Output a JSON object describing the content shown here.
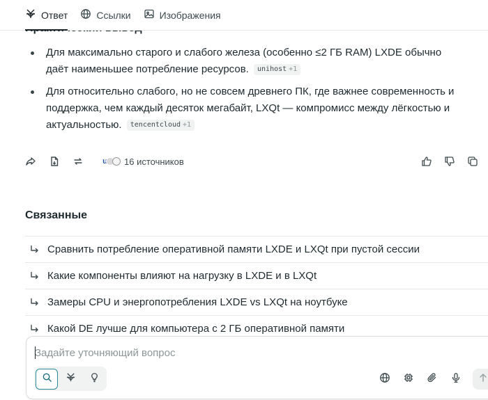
{
  "tabs": [
    {
      "label": "Ответ",
      "icon": "answer-icon",
      "active": true
    },
    {
      "label": "Ссылки",
      "icon": "globe-icon",
      "active": false
    },
    {
      "label": "Изображения",
      "icon": "image-icon",
      "active": false
    }
  ],
  "section_heading": "Практический вывод",
  "bullets": [
    {
      "text": "Для максимально старого и слабого железа (особенно ≤2 ГБ RAM) LXDE обычно даёт наименьшее потребление ресурсов.",
      "citation": "unihost",
      "citation_extra": "+1"
    },
    {
      "text": "Для относительно слабого, но не совсем древнего ПК, где важнее современность и поддержка, чем каждый десяток мегабайт, LXQt — компромисс между лёгкостью и актуальностью.",
      "citation": "tencentcloud",
      "citation_extra": "+1"
    }
  ],
  "actions": {
    "sources_label": "16 источников",
    "source_avatar_letter": "u"
  },
  "related": {
    "title": "Связанные",
    "items": [
      "Сравнить потребление оперативной памяти LXDE и LXQt при пустой сессии",
      "Какие компоненты влияют на нагрузку в LXDE и в LXQt",
      "Замеры CPU и энергопотребления LXDE vs LXQt на ноутбуке",
      "Какой DE лучше для компьютера с 2 ГБ оперативной памяти"
    ]
  },
  "composer": {
    "placeholder": "Задайте уточняющий вопрос"
  },
  "colors": {
    "accent": "#2a8a9a",
    "text": "#1f2a2e",
    "muted": "#8d9697"
  }
}
